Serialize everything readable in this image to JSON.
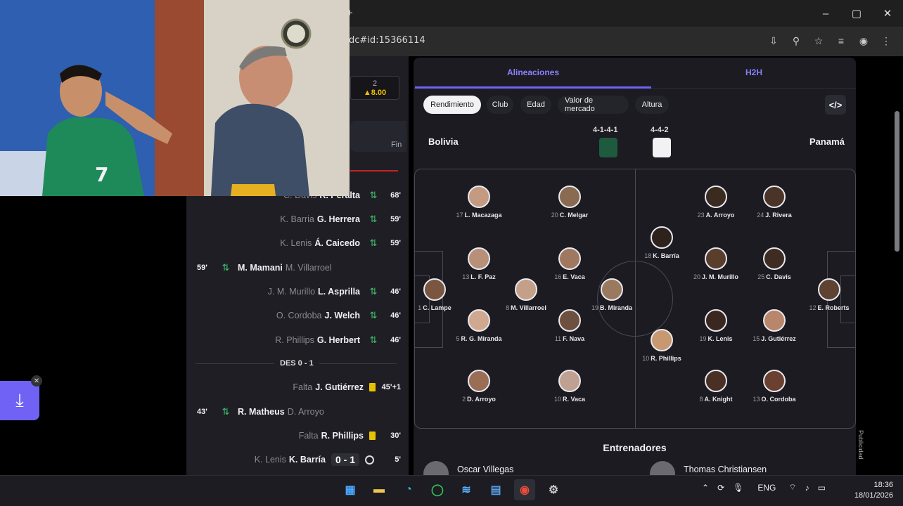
{
  "browser": {
    "url": "dc#id:15366114",
    "new_tab": "+",
    "window_controls": [
      "–",
      "▢",
      "✕"
    ]
  },
  "match_panel": {
    "odds_label": "2",
    "odds_value": "▲8.00",
    "status": "Fin",
    "events": [
      {
        "side": "right",
        "muted": "C. Davis",
        "main": "R. Peralta",
        "min": "68'",
        "type": "sub"
      },
      {
        "side": "right",
        "muted": "K. Barria",
        "main": "G. Herrera",
        "min": "59'",
        "type": "sub"
      },
      {
        "side": "right",
        "muted": "K. Lenis",
        "main": "Á. Caicedo",
        "min": "59'",
        "type": "sub"
      },
      {
        "side": "left",
        "min": "59'",
        "main": "M. Mamani",
        "muted": "M. Villarroel",
        "type": "sub"
      },
      {
        "side": "right",
        "muted": "J. M. Murillo",
        "main": "L. Asprilla",
        "min": "46'",
        "type": "sub"
      },
      {
        "side": "right",
        "muted": "O. Cordoba",
        "main": "J. Welch",
        "min": "46'",
        "type": "sub"
      },
      {
        "side": "right",
        "muted": "R. Phillips",
        "main": "G. Herbert",
        "min": "46'",
        "type": "sub"
      },
      {
        "side": "right",
        "muted": "Falta",
        "main": "J. Gutiérrez",
        "min": "45'+1",
        "type": "yellow"
      },
      {
        "side": "left",
        "min": "43'",
        "main": "R. Matheus",
        "muted": "D. Arroyo",
        "type": "sub"
      },
      {
        "side": "right",
        "muted": "Falta",
        "main": "R. Phillips",
        "min": "30'",
        "type": "yellow"
      },
      {
        "side": "right",
        "muted": "K. Lenis",
        "main": "K. Barría",
        "score": "0 - 1",
        "min": "5'",
        "type": "goal"
      }
    ],
    "divider_label": "DES 0 - 1"
  },
  "lineup": {
    "tabs": [
      "Alineaciones",
      "H2H"
    ],
    "filters": [
      "Rendimiento",
      "Club",
      "Edad",
      "Valor de mercado",
      "Altura"
    ],
    "embed_label": "</>",
    "home": {
      "name": "Bolivia",
      "formation": "4-1-4-1",
      "kit_color": "#1e5a3e"
    },
    "away": {
      "name": "Panamá",
      "formation": "4-4-2",
      "kit_color": "#f2f2f5"
    },
    "players": [
      {
        "num": "17",
        "name": "L. Macazaga"
      },
      {
        "num": "20",
        "name": "C. Melgar"
      },
      {
        "num": "13",
        "name": "L. F. Paz"
      },
      {
        "num": "16",
        "name": "E. Vaca"
      },
      {
        "num": "1",
        "name": "C. Lampe"
      },
      {
        "num": "8",
        "name": "M. Villarroel"
      },
      {
        "num": "19",
        "name": "B. Miranda"
      },
      {
        "num": "5",
        "name": "R. G. Miranda"
      },
      {
        "num": "11",
        "name": "F. Nava"
      },
      {
        "num": "2",
        "name": "D. Arroyo"
      },
      {
        "num": "10",
        "name": "R. Vaca"
      },
      {
        "num": "23",
        "name": "A. Arroyo"
      },
      {
        "num": "24",
        "name": "J. Rivera"
      },
      {
        "num": "18",
        "name": "K. Barría"
      },
      {
        "num": "20",
        "name": "J. M. Murillo"
      },
      {
        "num": "25",
        "name": "C. Davis"
      },
      {
        "num": "12",
        "name": "E. Roberts"
      },
      {
        "num": "19",
        "name": "K. Lenis"
      },
      {
        "num": "15",
        "name": "J. Gutiérrez"
      },
      {
        "num": "10",
        "name": "R. Phillips"
      },
      {
        "num": "8",
        "name": "A. Knight"
      },
      {
        "num": "13",
        "name": "O. Cordoba"
      }
    ],
    "coaches_title": "Entrenadores",
    "coaches": [
      "Oscar Villegas",
      "Thomas Christiansen"
    ],
    "ad_label": "Publicidad"
  },
  "taskbar": {
    "language": "ENG",
    "time": "18:36",
    "date": "18/01/2026"
  }
}
